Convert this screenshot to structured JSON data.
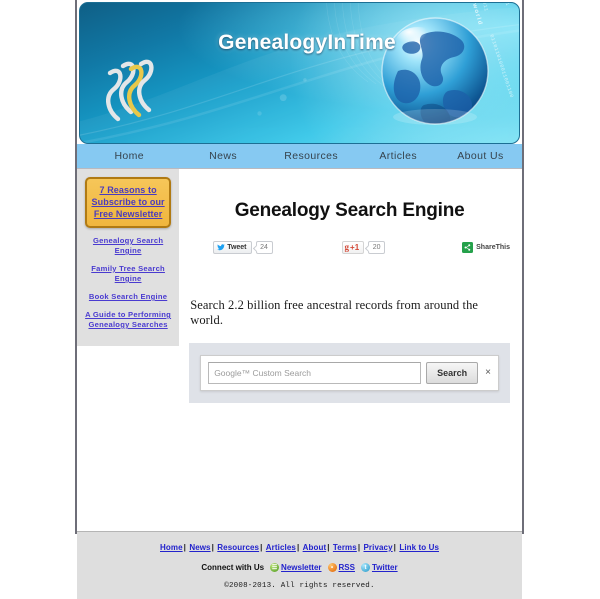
{
  "site": {
    "banner_title": "GenealogyInTime",
    "banner_decor_text": "connecting world",
    "binary_decor_1": "11001101100111001",
    "binary_decor_2": "10011100110011",
    "binary_decor_3": "0110110100011001100"
  },
  "nav": {
    "items": [
      {
        "label": "Home"
      },
      {
        "label": "News"
      },
      {
        "label": "Resources"
      },
      {
        "label": "Articles"
      },
      {
        "label": "About Us"
      }
    ]
  },
  "sidebar": {
    "newsletter": {
      "line1": "7 Reasons to",
      "line2": "Subscribe to our",
      "line3": "Free Newsletter"
    },
    "links": [
      {
        "label": "Genealogy Search Engine"
      },
      {
        "label": "Family Tree Search Engine"
      },
      {
        "label": "Book Search Engine"
      },
      {
        "label": "A Guide to Performing Genealogy Searches"
      }
    ]
  },
  "main": {
    "page_title": "Genealogy Search Engine",
    "description": "Search 2.2 billion free ancestral records from around the world.",
    "social": {
      "tweet_label": "Tweet",
      "tweet_count": "24",
      "gplus_label": "+1",
      "gplus_count": "20",
      "sharethis_label": "ShareThis"
    },
    "search": {
      "placeholder": "Google™ Custom Search",
      "value": "",
      "button_label": "Search",
      "close_label": "×"
    }
  },
  "footer": {
    "links": [
      {
        "label": "Home"
      },
      {
        "label": "News"
      },
      {
        "label": "Resources"
      },
      {
        "label": "Articles"
      },
      {
        "label": "About"
      },
      {
        "label": "Terms"
      },
      {
        "label": "Privacy"
      },
      {
        "label": "Link to Us"
      }
    ],
    "separator": "|",
    "connect_label": "Connect with Us",
    "connect_links": [
      {
        "label": "Newsletter"
      },
      {
        "label": "RSS"
      },
      {
        "label": "Twitter"
      }
    ],
    "copyright": "©2008-2013. All rights reserved."
  },
  "colors": {
    "nav_bg": "#86c9f2",
    "sidebar_bg": "#e0e0e0",
    "footer_bg": "#dedede",
    "newsletter_bg": "#f0b63e",
    "link_blue": "#2222cc",
    "search_panel_bg": "#dfe2e8"
  }
}
